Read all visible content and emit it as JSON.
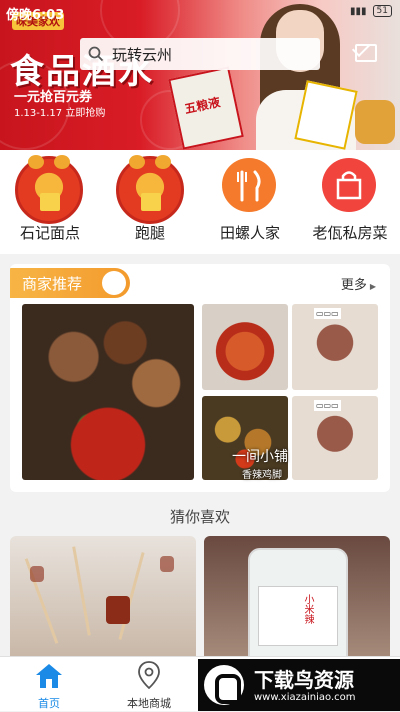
{
  "status_bar": {
    "time": "傍晚6:03",
    "battery": "51"
  },
  "banner": {
    "promo_small": "味美家欢",
    "title": "食品酒水",
    "subtitle": "一元抢百元券",
    "date": "1.13-1.17 立即抢购"
  },
  "search": {
    "text": "玩转云州"
  },
  "categories": [
    {
      "label": "石记面点",
      "icon": "ox-mascot-icon"
    },
    {
      "label": "跑腿",
      "icon": "ox-mascot-icon"
    },
    {
      "label": "田螺人家",
      "icon": "fork-knife-icon"
    },
    {
      "label": "老佤私房菜",
      "icon": "shopping-bag-icon"
    }
  ],
  "merchant": {
    "title": "商家推荐",
    "more": "更多",
    "overlay_name": "一间小铺",
    "overlay_sub": "香辣鸡脚"
  },
  "guess": {
    "title": "猜你喜欢",
    "jar_text": "小米辣"
  },
  "nav": [
    {
      "label": "首页",
      "icon": "home-icon",
      "active": true
    },
    {
      "label": "本地商城",
      "icon": "location-pin-icon",
      "active": false
    }
  ],
  "watermark": {
    "name": "下载鸟资源",
    "url": "www.xiazainiao.com"
  },
  "colors": {
    "accent": "#1a8ae6",
    "brand_red": "#c8151d",
    "merchant_tag": "#f7b545"
  }
}
